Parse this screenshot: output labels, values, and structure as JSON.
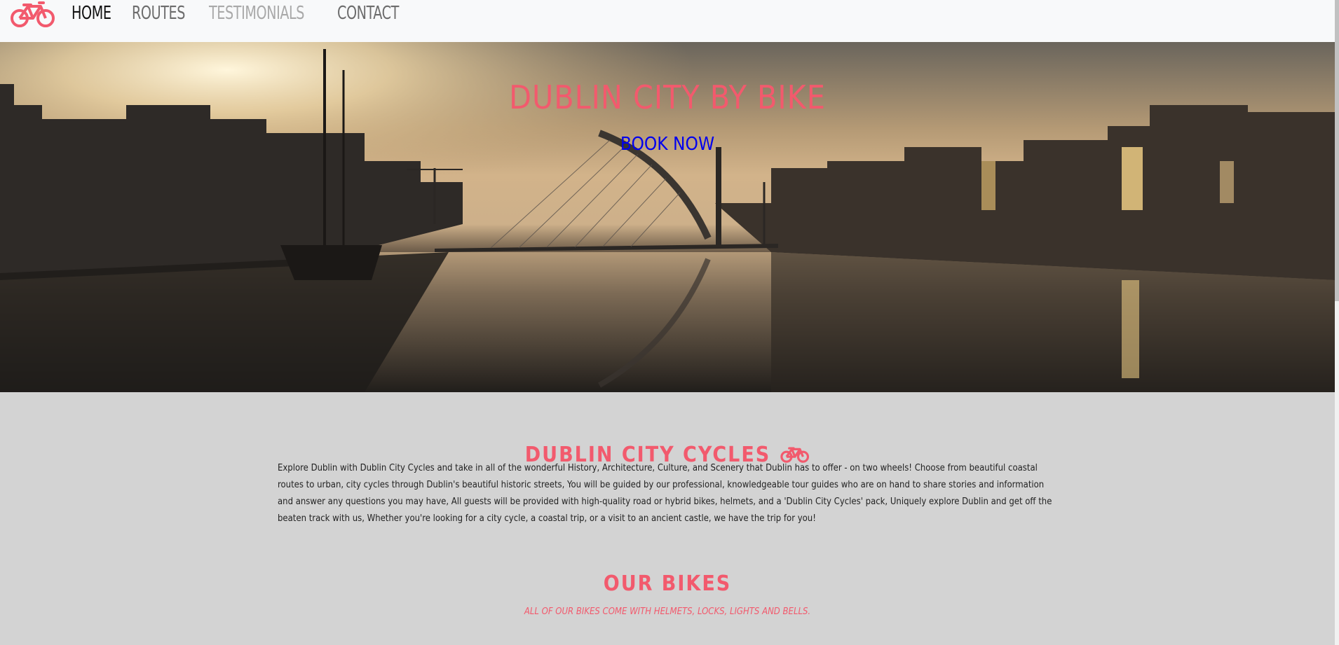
{
  "nav": {
    "brand_icon": "bicycle-icon",
    "links": [
      {
        "label": "HOME",
        "state": "active"
      },
      {
        "label": "ROUTES",
        "state": "default"
      },
      {
        "label": "TESTIMONIALS",
        "state": "muted"
      },
      {
        "label": "CONTACT",
        "state": "default"
      }
    ]
  },
  "hero": {
    "title": "DUBLIN CITY BY BIKE",
    "cta": "BOOK NOW"
  },
  "about": {
    "heading": "DUBLIN CITY CYCLES",
    "heading_icon": "bicycle-icon",
    "text": "Explore Dublin with Dublin City Cycles and take in all of the wonderful History, Architecture, Culture, and Scenery that Dublin has to offer - on two wheels! Choose from beautiful coastal routes to urban, city cycles through Dublin's beautiful historic streets, You will be guided by our professional, knowledgeable tour guides who are on hand to share stories and information and answer any questions you may have, All guests will be provided with high-quality road or hybrid bikes, helmets, and a 'Dublin City Cycles' pack, Uniquely explore Dublin and get off the beaten track with us, Whether you're looking for a city cycle, a coastal trip, or a visit to an ancient castle, we have the trip for you!"
  },
  "bikes": {
    "heading": "OUR BIKES",
    "subheading": "ALL OF OUR BIKES COME WITH HELMETS, LOCKS, LIGHTS AND BELLS."
  },
  "colors": {
    "accent": "#f25a6d",
    "link": "#0000ee",
    "section_bg": "#d3d3d3",
    "nav_bg": "#f8f9fa"
  }
}
